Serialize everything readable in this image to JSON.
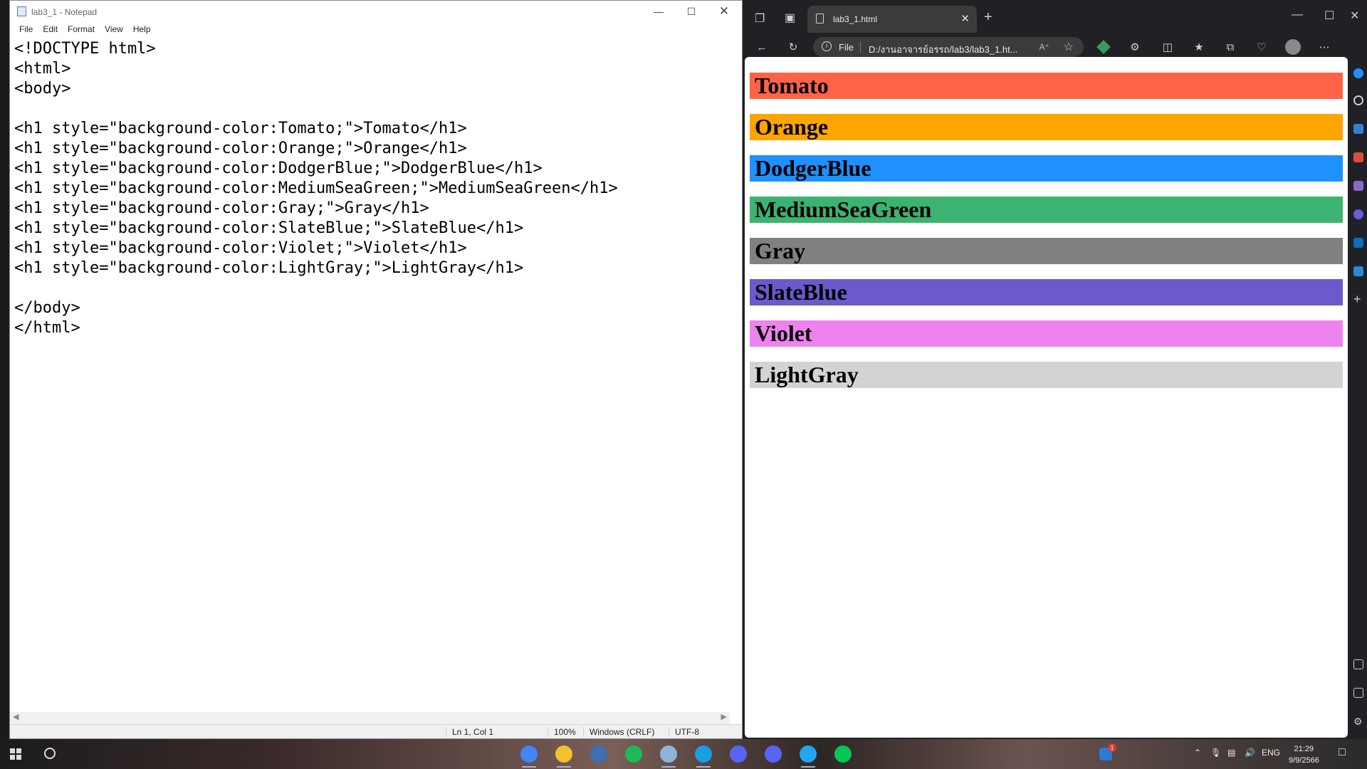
{
  "notepad": {
    "title": "lab3_1 - Notepad",
    "menu": [
      "File",
      "Edit",
      "Format",
      "View",
      "Help"
    ],
    "content": "<!DOCTYPE html>\n<html>\n<body>\n\n<h1 style=\"background-color:Tomato;\">Tomato</h1>\n<h1 style=\"background-color:Orange;\">Orange</h1>\n<h1 style=\"background-color:DodgerBlue;\">DodgerBlue</h1>\n<h1 style=\"background-color:MediumSeaGreen;\">MediumSeaGreen</h1>\n<h1 style=\"background-color:Gray;\">Gray</h1>\n<h1 style=\"background-color:SlateBlue;\">SlateBlue</h1>\n<h1 style=\"background-color:Violet;\">Violet</h1>\n<h1 style=\"background-color:LightGray;\">LightGray</h1>\n\n</body>\n</html>",
    "status": {
      "position": "Ln 1, Col 1",
      "zoom": "100%",
      "line_endings": "Windows (CRLF)",
      "encoding": "UTF-8"
    }
  },
  "browser": {
    "tab_title": "lab3_1.html",
    "address_label": "File",
    "address_url": "D:/งานอาจารย์อรรถ/lab3/lab3_1.ht...",
    "headings": [
      {
        "text": "Tomato",
        "color": "#FF6347"
      },
      {
        "text": "Orange",
        "color": "#FFA500"
      },
      {
        "text": "DodgerBlue",
        "color": "#1E90FF"
      },
      {
        "text": "MediumSeaGreen",
        "color": "#3CB371"
      },
      {
        "text": "Gray",
        "color": "#808080"
      },
      {
        "text": "SlateBlue",
        "color": "#6A5ACD"
      },
      {
        "text": "Violet",
        "color": "#EE82EE"
      },
      {
        "text": "LightGray",
        "color": "#D3D3D3"
      }
    ]
  },
  "taskbar": {
    "apps": [
      {
        "name": "chrome-icon",
        "color": "#4285F4"
      },
      {
        "name": "file-explorer-icon",
        "color": "#F3C02E"
      },
      {
        "name": "calculator-icon",
        "color": "#3d6fb3"
      },
      {
        "name": "spotify-icon",
        "color": "#1DB954"
      },
      {
        "name": "notepad-icon",
        "color": "#8fb4d8"
      },
      {
        "name": "edge-icon",
        "color": "#1b9de2"
      },
      {
        "name": "discord-icon",
        "color": "#5865F2"
      },
      {
        "name": "discord-icon",
        "color": "#5865F2"
      },
      {
        "name": "vscode-icon",
        "color": "#22a6f2"
      },
      {
        "name": "line-icon",
        "color": "#06C755"
      }
    ],
    "notification_badge": "1",
    "language": "ENG",
    "time": "21:29",
    "date": "9/9/2566"
  }
}
